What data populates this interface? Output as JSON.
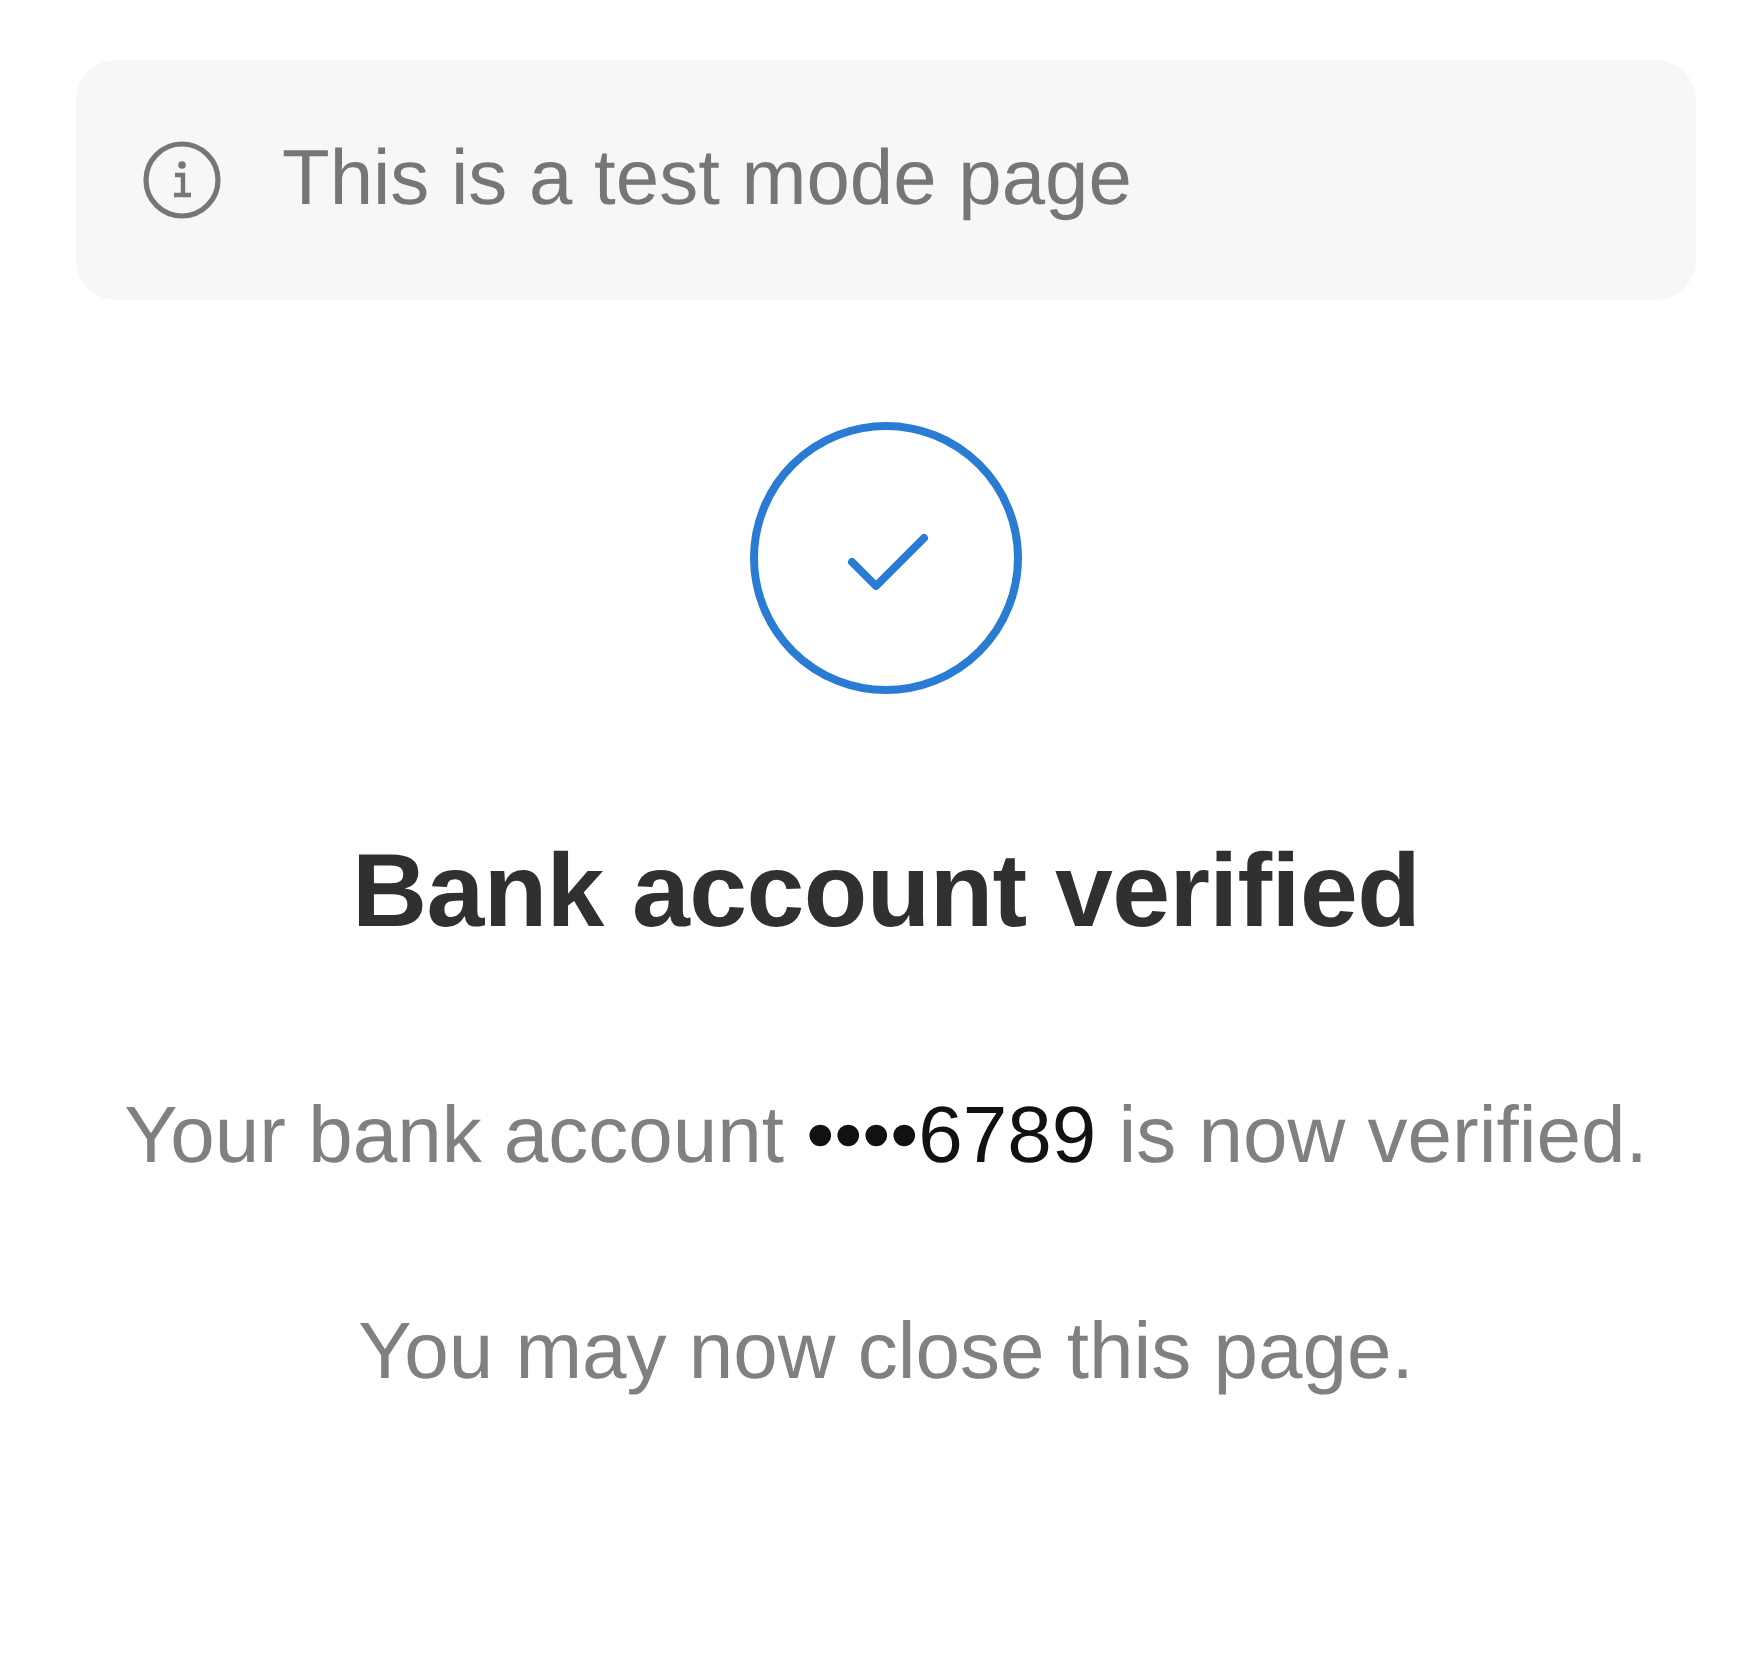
{
  "banner": {
    "text": "This is a test mode page"
  },
  "status": {
    "kind": "success"
  },
  "title": "Bank account verified",
  "message": {
    "parts": [
      {
        "kind": "plain",
        "text": "Your bank account"
      },
      {
        "kind": "account",
        "text": "••••6789"
      },
      {
        "kind": "plain",
        "text": "is now verified."
      }
    ]
  },
  "note": "You may now close this page."
}
